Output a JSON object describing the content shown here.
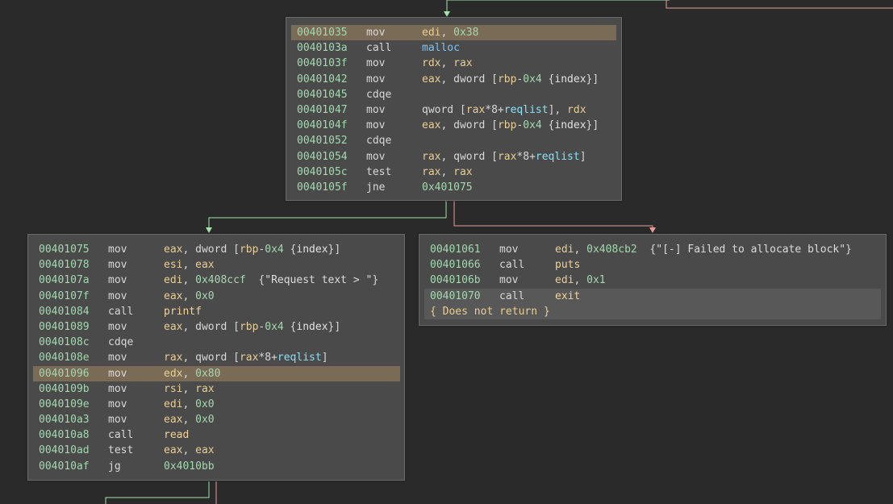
{
  "colors": {
    "background": "#2a2a2a",
    "block_bg": "#4a4a4a",
    "address": "#a2d9af",
    "register": "#e9ce95",
    "symbol": "#8ae0f5",
    "highlight": "#7a6b56",
    "edge_true": "#a3e4a8",
    "edge_false": "#e89a9a"
  },
  "blocks": [
    {
      "id": "block-401035",
      "lines": [
        {
          "addr": "00401035",
          "mnem": "mov",
          "ops": [
            [
              "reg",
              "edi"
            ],
            [
              "punc",
              ", "
            ],
            [
              "num",
              "0x38"
            ]
          ],
          "highlight": true
        },
        {
          "addr": "0040103a",
          "mnem": "call",
          "ops": [
            [
              "fn",
              "malloc"
            ]
          ]
        },
        {
          "addr": "0040103f",
          "mnem": "mov",
          "ops": [
            [
              "reg",
              "rdx"
            ],
            [
              "punc",
              ", "
            ],
            [
              "reg",
              "rax"
            ]
          ]
        },
        {
          "addr": "00401042",
          "mnem": "mov",
          "ops": [
            [
              "reg",
              "eax"
            ],
            [
              "punc",
              ", dword ["
            ],
            [
              "reg",
              "rbp"
            ],
            [
              "punc",
              "-"
            ],
            [
              "num",
              "0x4"
            ],
            [
              "punc",
              " {"
            ],
            [
              "var",
              "index"
            ],
            [
              "punc",
              "}]"
            ]
          ]
        },
        {
          "addr": "00401045",
          "mnem": "cdqe",
          "ops": []
        },
        {
          "addr": "00401047",
          "mnem": "mov",
          "ops": [
            [
              "punc",
              "qword ["
            ],
            [
              "reg",
              "rax"
            ],
            [
              "punc",
              "*8+"
            ],
            [
              "sym",
              "reqlist"
            ],
            [
              "punc",
              "], "
            ],
            [
              "reg",
              "rdx"
            ]
          ]
        },
        {
          "addr": "0040104f",
          "mnem": "mov",
          "ops": [
            [
              "reg",
              "eax"
            ],
            [
              "punc",
              ", dword ["
            ],
            [
              "reg",
              "rbp"
            ],
            [
              "punc",
              "-"
            ],
            [
              "num",
              "0x4"
            ],
            [
              "punc",
              " {"
            ],
            [
              "var",
              "index"
            ],
            [
              "punc",
              "}]"
            ]
          ]
        },
        {
          "addr": "00401052",
          "mnem": "cdqe",
          "ops": []
        },
        {
          "addr": "00401054",
          "mnem": "mov",
          "ops": [
            [
              "reg",
              "rax"
            ],
            [
              "punc",
              ", qword ["
            ],
            [
              "reg",
              "rax"
            ],
            [
              "punc",
              "*8+"
            ],
            [
              "sym",
              "reqlist"
            ],
            [
              "punc",
              "]"
            ]
          ]
        },
        {
          "addr": "0040105c",
          "mnem": "test",
          "ops": [
            [
              "reg",
              "rax"
            ],
            [
              "punc",
              ", "
            ],
            [
              "reg",
              "rax"
            ]
          ]
        },
        {
          "addr": "0040105f",
          "mnem": "jne",
          "ops": [
            [
              "num",
              "0x401075"
            ]
          ]
        }
      ]
    },
    {
      "id": "block-401075",
      "lines": [
        {
          "addr": "00401075",
          "mnem": "mov",
          "ops": [
            [
              "reg",
              "eax"
            ],
            [
              "punc",
              ", dword ["
            ],
            [
              "reg",
              "rbp"
            ],
            [
              "punc",
              "-"
            ],
            [
              "num",
              "0x4"
            ],
            [
              "punc",
              " {"
            ],
            [
              "var",
              "index"
            ],
            [
              "punc",
              "}]"
            ]
          ]
        },
        {
          "addr": "00401078",
          "mnem": "mov",
          "ops": [
            [
              "reg",
              "esi"
            ],
            [
              "punc",
              ", "
            ],
            [
              "reg",
              "eax"
            ]
          ]
        },
        {
          "addr": "0040107a",
          "mnem": "mov",
          "ops": [
            [
              "reg",
              "edi"
            ],
            [
              "punc",
              ", "
            ],
            [
              "num",
              "0x408ccf"
            ],
            [
              "punc",
              "  {"
            ],
            [
              "str",
              "\"Request text > \""
            ],
            [
              "punc",
              "}"
            ]
          ]
        },
        {
          "addr": "0040107f",
          "mnem": "mov",
          "ops": [
            [
              "reg",
              "eax"
            ],
            [
              "punc",
              ", "
            ],
            [
              "num",
              "0x0"
            ]
          ]
        },
        {
          "addr": "00401084",
          "mnem": "call",
          "ops": [
            [
              "fn2",
              "printf"
            ]
          ]
        },
        {
          "addr": "00401089",
          "mnem": "mov",
          "ops": [
            [
              "reg",
              "eax"
            ],
            [
              "punc",
              ", dword ["
            ],
            [
              "reg",
              "rbp"
            ],
            [
              "punc",
              "-"
            ],
            [
              "num",
              "0x4"
            ],
            [
              "punc",
              " {"
            ],
            [
              "var",
              "index"
            ],
            [
              "punc",
              "}]"
            ]
          ]
        },
        {
          "addr": "0040108c",
          "mnem": "cdqe",
          "ops": []
        },
        {
          "addr": "0040108e",
          "mnem": "mov",
          "ops": [
            [
              "reg",
              "rax"
            ],
            [
              "punc",
              ", qword ["
            ],
            [
              "reg",
              "rax"
            ],
            [
              "punc",
              "*8+"
            ],
            [
              "sym",
              "reqlist"
            ],
            [
              "punc",
              "]"
            ]
          ]
        },
        {
          "addr": "00401096",
          "mnem": "mov",
          "ops": [
            [
              "reg",
              "edx"
            ],
            [
              "punc",
              ", "
            ],
            [
              "num",
              "0x80"
            ]
          ],
          "highlight": true
        },
        {
          "addr": "0040109b",
          "mnem": "mov",
          "ops": [
            [
              "reg",
              "rsi"
            ],
            [
              "punc",
              ", "
            ],
            [
              "reg",
              "rax"
            ]
          ]
        },
        {
          "addr": "0040109e",
          "mnem": "mov",
          "ops": [
            [
              "reg",
              "edi"
            ],
            [
              "punc",
              ", "
            ],
            [
              "num",
              "0x0"
            ]
          ]
        },
        {
          "addr": "004010a3",
          "mnem": "mov",
          "ops": [
            [
              "reg",
              "eax"
            ],
            [
              "punc",
              ", "
            ],
            [
              "num",
              "0x0"
            ]
          ]
        },
        {
          "addr": "004010a8",
          "mnem": "call",
          "ops": [
            [
              "fn2",
              "read"
            ]
          ]
        },
        {
          "addr": "004010ad",
          "mnem": "test",
          "ops": [
            [
              "reg",
              "eax"
            ],
            [
              "punc",
              ", "
            ],
            [
              "reg",
              "eax"
            ]
          ]
        },
        {
          "addr": "004010af",
          "mnem": "jg",
          "ops": [
            [
              "num",
              "0x4010bb"
            ]
          ]
        }
      ]
    },
    {
      "id": "block-401061",
      "lines": [
        {
          "addr": "00401061",
          "mnem": "mov",
          "ops": [
            [
              "reg",
              "edi"
            ],
            [
              "punc",
              ", "
            ],
            [
              "num",
              "0x408cb2"
            ],
            [
              "punc",
              "  {"
            ],
            [
              "str",
              "\"[-] Failed to allocate block\""
            ],
            [
              "punc",
              "}"
            ]
          ]
        },
        {
          "addr": "00401066",
          "mnem": "call",
          "ops": [
            [
              "fn2",
              "puts"
            ]
          ]
        },
        {
          "addr": "0040106b",
          "mnem": "mov",
          "ops": [
            [
              "reg",
              "edi"
            ],
            [
              "punc",
              ", "
            ],
            [
              "num",
              "0x1"
            ]
          ]
        },
        {
          "addr": "00401070",
          "mnem": "call",
          "ops": [
            [
              "fn2",
              "exit"
            ]
          ],
          "selected": true
        }
      ],
      "no_return": "{ Does not return }"
    }
  ]
}
